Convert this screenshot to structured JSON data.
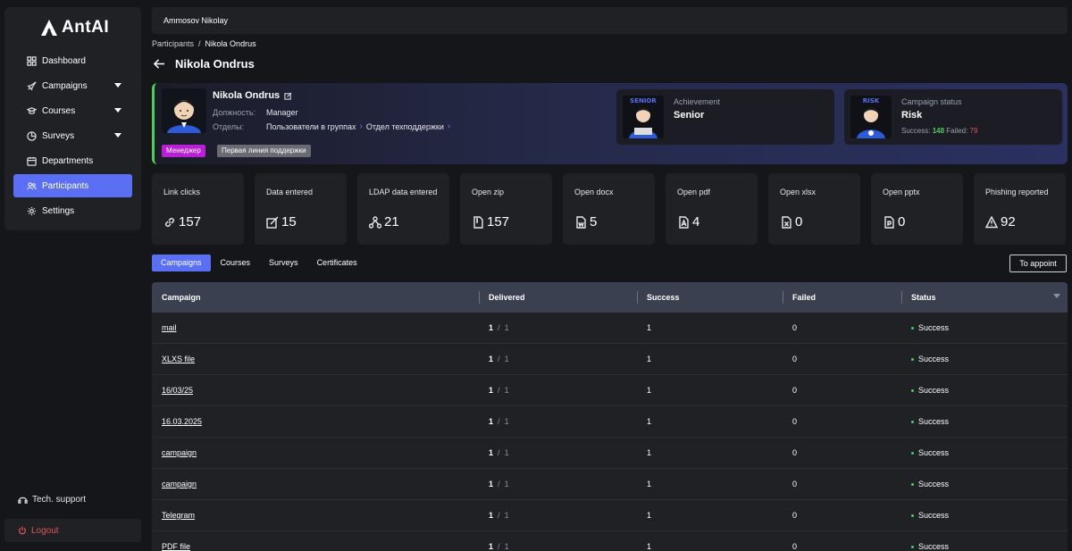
{
  "brand": {
    "name": "AntAI"
  },
  "sidebar": {
    "items": [
      {
        "label": "Dashboard",
        "icon": "grid-icon"
      },
      {
        "label": "Campaigns",
        "icon": "rocket-icon"
      },
      {
        "label": "Courses",
        "icon": "graduation-cap-icon"
      },
      {
        "label": "Surveys",
        "icon": "pie-chart-icon"
      },
      {
        "label": "Departments",
        "icon": "calendar-icon"
      },
      {
        "label": "Participants",
        "icon": "users-icon"
      },
      {
        "label": "Settings",
        "icon": "gear-icon"
      }
    ],
    "tech_support": "Tech. support",
    "logout": "Logout"
  },
  "topbar": {
    "user": "Ammosov Nikolay"
  },
  "breadcrumb": {
    "parent": "Participants",
    "sep": "/",
    "current": "Nikola Ondrus"
  },
  "page": {
    "title": "Nikola Ondrus"
  },
  "profile": {
    "name": "Nikola Ondrus",
    "position_label": "Должность:",
    "position": "Manager",
    "departments_label": "Отделы:",
    "dept_path": [
      "Пользователи в группах",
      "Отдел техподдержки"
    ],
    "tags": [
      "Менеджер",
      "Первая линия поддержки"
    ],
    "achievement": {
      "label": "Achievement",
      "value": "Senior",
      "badge": "SENIOR"
    },
    "campaign_status": {
      "label": "Campaign status",
      "value": "Risk",
      "badge": "RISK",
      "success_label": "Success:",
      "success": "148",
      "failed_label": "Failed:",
      "failed": "79"
    }
  },
  "stats": [
    {
      "label": "Link clicks",
      "value": "157",
      "icon": "link-icon"
    },
    {
      "label": "Data entered",
      "value": "15",
      "icon": "edit-icon"
    },
    {
      "label": "LDAP data entered",
      "value": "21",
      "icon": "ldap-icon"
    },
    {
      "label": "Open zip",
      "value": "157",
      "icon": "zip-file-icon"
    },
    {
      "label": "Open docx",
      "value": "5",
      "icon": "docx-file-icon"
    },
    {
      "label": "Open pdf",
      "value": "4",
      "icon": "pdf-file-icon"
    },
    {
      "label": "Open xlsx",
      "value": "0",
      "icon": "xlsx-file-icon"
    },
    {
      "label": "Open pptx",
      "value": "0",
      "icon": "pptx-file-icon"
    },
    {
      "label": "Phishing reported",
      "value": "92",
      "icon": "warning-icon"
    }
  ],
  "tabs": [
    "Campaigns",
    "Courses",
    "Surveys",
    "Certificates"
  ],
  "actions": {
    "appoint": "To appoint"
  },
  "table": {
    "headers": [
      "Campaign",
      "Delivered",
      "Success",
      "Failed",
      "Status"
    ],
    "rows": [
      {
        "campaign": "mail",
        "delivered": "1",
        "total": "1",
        "success": "1",
        "failed": "0",
        "status": "Success"
      },
      {
        "campaign": "XLXS file",
        "delivered": "1",
        "total": "1",
        "success": "1",
        "failed": "0",
        "status": "Success"
      },
      {
        "campaign": "16/03/25",
        "delivered": "1",
        "total": "1",
        "success": "1",
        "failed": "0",
        "status": "Success"
      },
      {
        "campaign": "16.03.2025",
        "delivered": "1",
        "total": "1",
        "success": "1",
        "failed": "0",
        "status": "Success"
      },
      {
        "campaign": "campaign",
        "delivered": "1",
        "total": "1",
        "success": "1",
        "failed": "0",
        "status": "Success"
      },
      {
        "campaign": "campaign",
        "delivered": "1",
        "total": "1",
        "success": "1",
        "failed": "0",
        "status": "Success"
      },
      {
        "campaign": "Telegram",
        "delivered": "1",
        "total": "1",
        "success": "1",
        "failed": "0",
        "status": "Success"
      },
      {
        "campaign": "PDF file",
        "delivered": "1",
        "total": "1",
        "success": "1",
        "failed": "0",
        "status": "Success"
      }
    ]
  },
  "colors": {
    "accent": "#5b6ff5",
    "success": "#4ccf5e",
    "danger": "#e25454",
    "tag_manager": "#b81fd6"
  }
}
